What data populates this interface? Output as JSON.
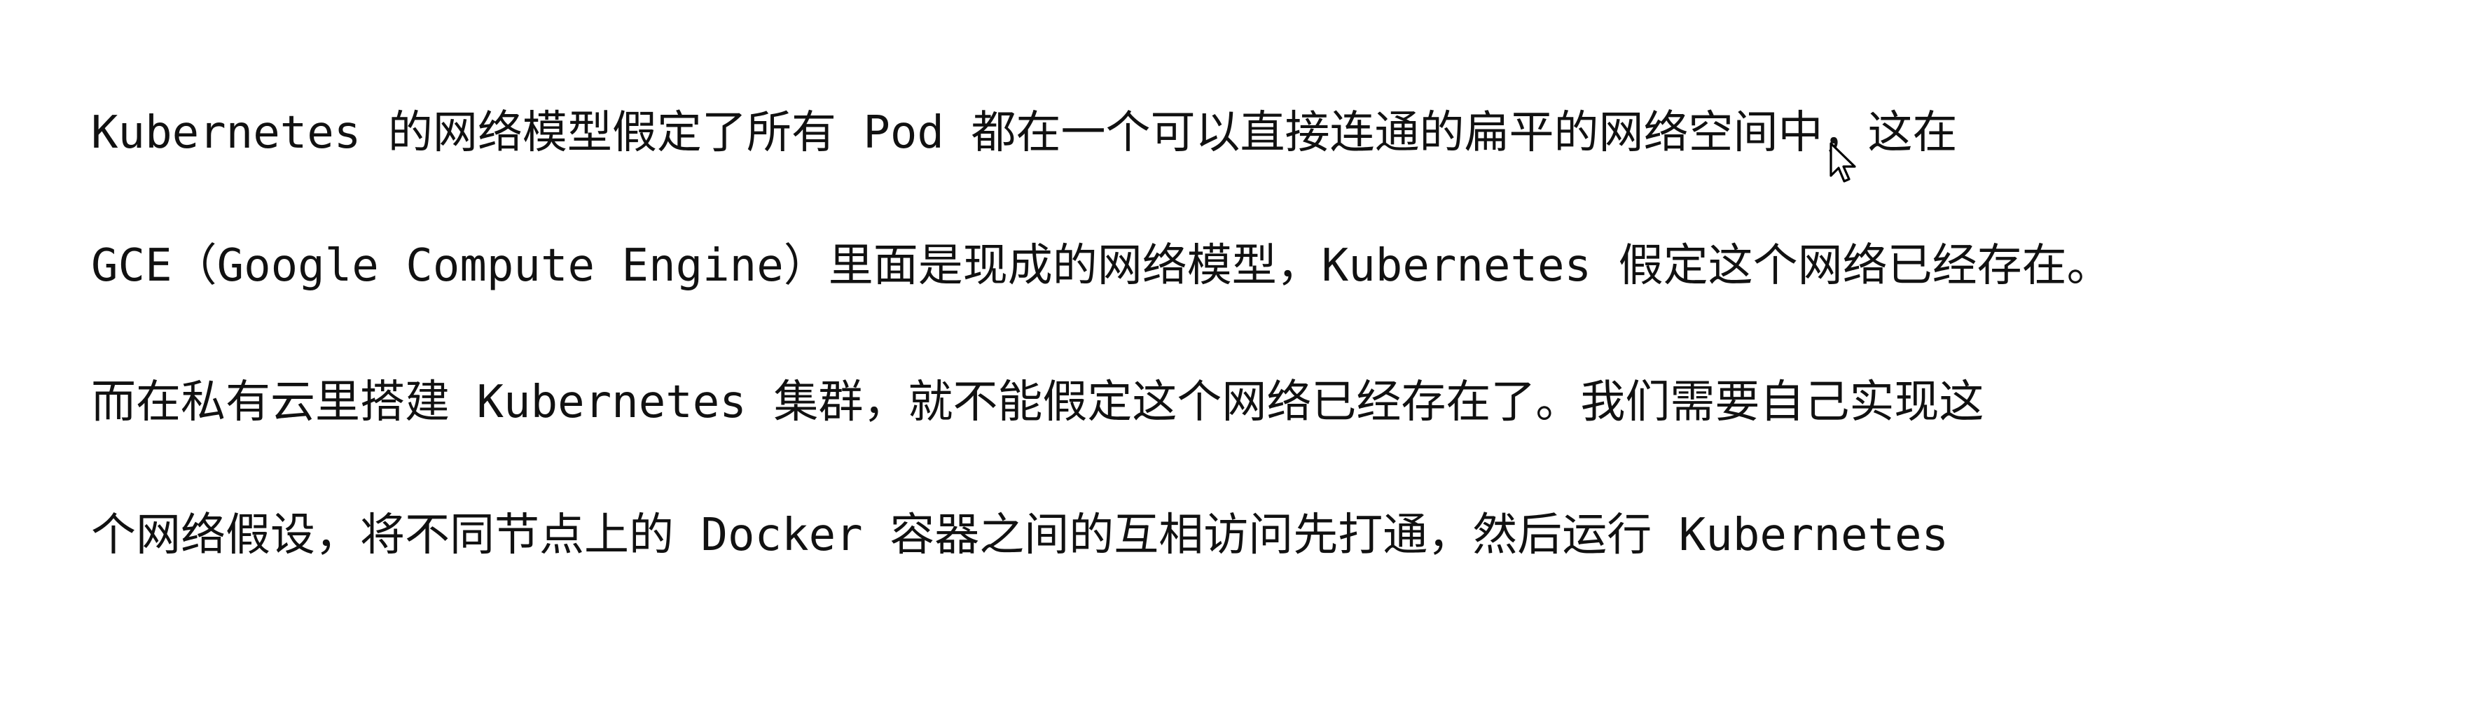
{
  "document": {
    "lines": [
      "Kubernetes 的网络模型假定了所有 Pod 都在一个可以直接连通的扁平的网络空间中，这在",
      "GCE（Google Compute Engine）里面是现成的网络模型，Kubernetes 假定这个网络已经存在。",
      "而在私有云里搭建 Kubernetes 集群，就不能假定这个网络已经存在了。我们需要自己实现这",
      "个网络假设，将不同节点上的 Docker 容器之间的互相访问先打通，然后运行 Kubernetes"
    ]
  },
  "cursor": {
    "icon": "mouse-pointer-icon"
  }
}
